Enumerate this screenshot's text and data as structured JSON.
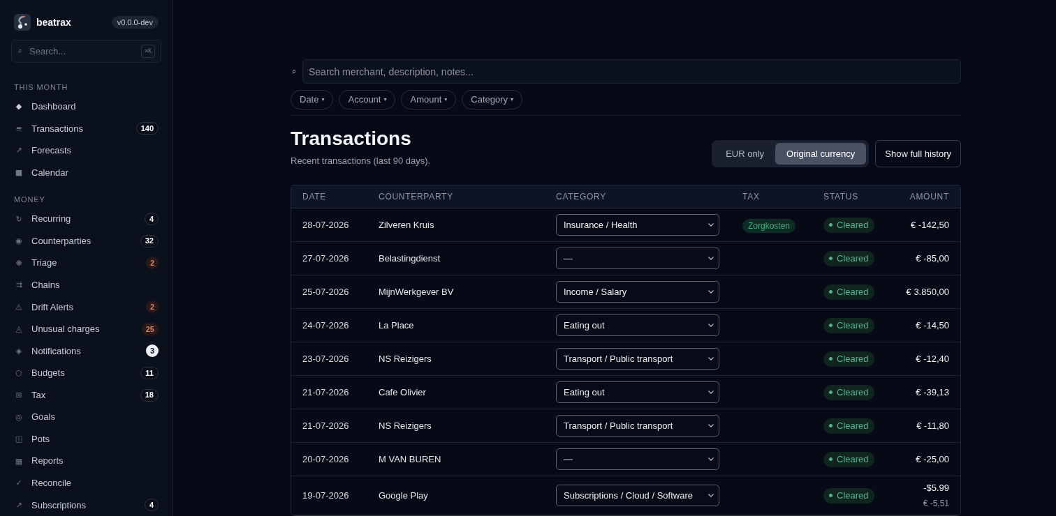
{
  "sidebar": {
    "app_name": "beatrax",
    "version": "v0.0.0-dev",
    "search": {
      "icon": "⌕",
      "placeholder": "Search...",
      "shortcut": "⌘K"
    },
    "sections": [
      {
        "title": "THIS MONTH",
        "items": [
          {
            "icon": "◆",
            "label": "Dashboard"
          },
          {
            "icon": "≡",
            "label": "Transactions",
            "badge": {
              "text": "140",
              "kind": "neutral"
            }
          },
          {
            "icon": "↗",
            "label": "Forecasts"
          },
          {
            "icon": "■",
            "label": "Calendar"
          }
        ]
      },
      {
        "title": "MONEY",
        "items": [
          {
            "icon": "↻",
            "label": "Recurring",
            "badge": {
              "text": "4",
              "kind": "neutral"
            }
          },
          {
            "icon": "◉",
            "label": "Counterparties",
            "badge": {
              "text": "32",
              "kind": "neutral"
            }
          },
          {
            "icon": "❋",
            "label": "Triage",
            "badge": {
              "text": "2",
              "kind": "alert"
            }
          },
          {
            "icon": "⇉",
            "label": "Chains"
          },
          {
            "icon": "⚠",
            "label": "Drift Alerts",
            "badge": {
              "text": "2",
              "kind": "alert"
            }
          },
          {
            "icon": "◬",
            "label": "Unusual charges",
            "badge": {
              "text": "25",
              "kind": "alert"
            }
          },
          {
            "icon": "◈",
            "label": "Notifications",
            "badge": {
              "text": "3",
              "kind": "highlight"
            }
          },
          {
            "icon": "○",
            "label": "Budgets",
            "badge": {
              "text": "11",
              "kind": "neutral"
            }
          },
          {
            "icon": "⊞",
            "label": "Tax",
            "badge": {
              "text": "18",
              "kind": "neutral"
            }
          },
          {
            "icon": "◎",
            "label": "Goals"
          },
          {
            "icon": "◫",
            "label": "Pots"
          },
          {
            "icon": "▦",
            "label": "Reports"
          },
          {
            "icon": "✓",
            "label": "Reconcile"
          },
          {
            "icon": "↗",
            "label": "Subscriptions",
            "badge": {
              "text": "4",
              "kind": "neutral"
            }
          }
        ]
      }
    ]
  },
  "main": {
    "search": {
      "icon": "⌕",
      "placeholder": "Search merchant, description, notes..."
    },
    "filters": [
      {
        "label": "Date",
        "caret": "▾"
      },
      {
        "label": "Account",
        "caret": "▾"
      },
      {
        "label": "Amount",
        "caret": "▾"
      },
      {
        "label": "Category",
        "caret": "▾"
      }
    ],
    "title": "Transactions",
    "subtitle": "Recent transactions (last 90 days).",
    "currency_toggle": [
      {
        "label": "EUR only",
        "selected": false
      },
      {
        "label": "Original currency",
        "selected": true
      }
    ],
    "history_button": "Show full history",
    "table": {
      "columns": [
        "DATE",
        "COUNTERPARTY",
        "CATEGORY",
        "TAX",
        "STATUS",
        "AMOUNT"
      ],
      "rows": [
        {
          "date": "28-07-2026",
          "counterparty": "Zilveren Kruis",
          "category": "Insurance / Health",
          "tax": "Zorgkosten",
          "status": {
            "text": "Cleared",
            "kind": "cleared"
          },
          "amount": "€ -142,50"
        },
        {
          "date": "27-07-2026",
          "counterparty": "Belastingdienst",
          "category": "—",
          "status": {
            "text": "Cleared",
            "kind": "cleared"
          },
          "amount": "€ -85,00"
        },
        {
          "date": "25-07-2026",
          "counterparty": "MijnWerkgever BV",
          "category": "Income / Salary",
          "status": {
            "text": "Cleared",
            "kind": "cleared"
          },
          "amount": "€ 3.850,00"
        },
        {
          "date": "24-07-2026",
          "counterparty": "La Place",
          "category": "Eating out",
          "status": {
            "text": "Cleared",
            "kind": "cleared"
          },
          "amount": "€ -14,50"
        },
        {
          "date": "23-07-2026",
          "counterparty": "NS Reizigers",
          "category": "Transport / Public transport",
          "status": {
            "text": "Cleared",
            "kind": "cleared"
          },
          "amount": "€ -12,40"
        },
        {
          "date": "21-07-2026",
          "counterparty": "Cafe Olivier",
          "category": "Eating out",
          "status": {
            "text": "Cleared",
            "kind": "cleared"
          },
          "amount": "€ -39,13"
        },
        {
          "date": "21-07-2026",
          "counterparty": "NS Reizigers",
          "category": "Transport / Public transport",
          "status": {
            "text": "Cleared",
            "kind": "cleared"
          },
          "amount": "€ -11,80"
        },
        {
          "date": "20-07-2026",
          "counterparty": "M VAN BUREN",
          "category": "—",
          "status": {
            "text": "Cleared",
            "kind": "cleared"
          },
          "amount": "€ -25,00"
        },
        {
          "date": "19-07-2026",
          "counterparty": "Google Play",
          "category": "Subscriptions / Cloud / Software",
          "status": {
            "text": "Cleared",
            "kind": "cleared"
          },
          "amount": "-$5.99",
          "amount_eur": "€ -5,51"
        }
      ]
    }
  }
}
